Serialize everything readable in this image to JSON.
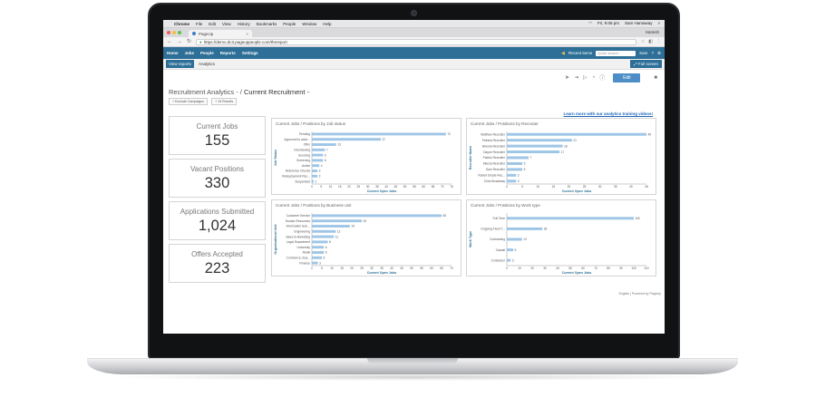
{
  "os": {
    "app_name": "Chrome",
    "menu": [
      "File",
      "Edit",
      "View",
      "History",
      "Bookmarks",
      "People",
      "Window",
      "Help"
    ],
    "status_user": "Hamish",
    "clock": "Fri, 9:06 pm",
    "user": "Sam Hamaway"
  },
  "browser": {
    "tab_title": "Pagecip",
    "url": "https://demo.dc3.pageuppeople.com/thereport"
  },
  "app": {
    "nav": [
      "Home",
      "Jobs",
      "People",
      "Reports",
      "Settings"
    ],
    "recent_items": "Recent items",
    "search_placeholder": "Quick search",
    "user_pill": "Sam",
    "subtabs": [
      "View reports",
      "Analytics"
    ],
    "fullscreen": "Full screen",
    "edit_label": "Edit",
    "breadcrumb_parent": "Recruitment Analytics -",
    "breadcrumb_sep": "/",
    "breadcrumb_current": "Current Recruitment -",
    "chips": [
      "+ Exclude Campaigns",
      "+ 15 Results"
    ],
    "learn_link": "Learn more with our analytics training videos!",
    "footer": "English  |  Powered by Pagecip"
  },
  "kpis": [
    {
      "label": "Current Jobs",
      "value": "155"
    },
    {
      "label": "Vacant Positions",
      "value": "330"
    },
    {
      "label": "Applications Submitted",
      "value": "1,024"
    },
    {
      "label": "Offers Accepted",
      "value": "223"
    }
  ],
  "colors": {
    "bar": "#9fc6e6",
    "nav": "#2d6f97",
    "edit": "#4d8ec6"
  },
  "chart_data": [
    {
      "type": "bar",
      "orientation": "horizontal",
      "title": "Current Jobs / Positions by Job status",
      "ylabel": "Job Status",
      "xlabel": "Current Open Jobs",
      "categories": [
        "Pending",
        "Approved to adve...",
        "Offer",
        "Interviewing",
        "Sourcing",
        "Screening",
        "Active",
        "Reference Checks",
        "Redeployment Rec...",
        "Suspended"
      ],
      "values": [
        72,
        37,
        13,
        7,
        6,
        6,
        4,
        3,
        3,
        1
      ],
      "xlim": [
        0,
        75
      ],
      "xticks": [
        0,
        5,
        10,
        15,
        20,
        25,
        30,
        35,
        40,
        45,
        50,
        55,
        60,
        65,
        70,
        75
      ]
    },
    {
      "type": "bar",
      "orientation": "horizontal",
      "title": "Current Jobs / Positions by Recruiter",
      "ylabel": "Recruiter Name",
      "xlabel": "Current Open Jobs",
      "categories": [
        "Matthew Recruiter",
        "Patricia Recruiter",
        "Brenda Recruiter",
        "Dayne Recruiter",
        "Patrick Recruiter",
        "Marcia Recruiter",
        "Sam Recruiter",
        "Robert Emple Rec...",
        "Chris Broadway"
      ],
      "values": [
        45,
        21,
        18,
        17,
        7,
        5,
        5,
        3,
        3
      ],
      "xlim": [
        0,
        45
      ],
      "xticks": [
        0,
        5,
        10,
        15,
        20,
        25,
        30,
        35,
        40,
        45
      ]
    },
    {
      "type": "bar",
      "orientation": "horizontal",
      "title": "Current Jobs / Positions by Business unit",
      "ylabel": "Organisational Unit",
      "xlabel": "Current Open Jobs",
      "categories": [
        "Customer Service",
        "Human Resources",
        "Information tech...",
        "Engineering",
        "Sales & Marketing",
        "Legal Department",
        "University",
        "Retail",
        "Commerce, Bus...",
        "Finance"
      ],
      "values": [
        65,
        25,
        19,
        12,
        11,
        8,
        6,
        6,
        5,
        3
      ],
      "xlim": [
        0,
        70
      ],
      "xticks": [
        0,
        5,
        10,
        15,
        20,
        25,
        30,
        35,
        40,
        45,
        50,
        55,
        60,
        65,
        70
      ]
    },
    {
      "type": "bar",
      "orientation": "horizontal",
      "title": "Current Jobs / Positions by Work type",
      "ylabel": "Work Type",
      "xlabel": "Current Open Jobs",
      "categories": [
        "Full Time",
        "Ongoing Fixed T...",
        "Contracting",
        "Casual",
        "Contractor"
      ],
      "values": [
        100,
        28,
        12,
        5,
        3
      ],
      "xlim": [
        0,
        110
      ],
      "xticks": [
        0,
        10,
        20,
        30,
        40,
        50,
        60,
        70,
        80,
        90,
        100,
        110
      ]
    }
  ]
}
